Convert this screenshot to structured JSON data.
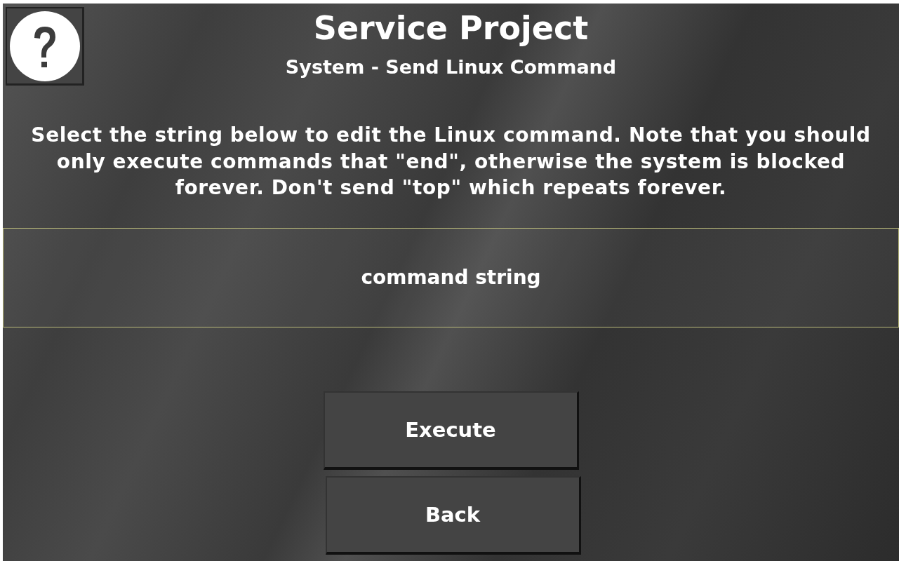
{
  "title": "Service Project",
  "subtitle": "System - Send Linux Command",
  "instructions": "Select the string below to edit the Linux command. Note that you should only execute commands that \"end\", otherwise the system is blocked forever. Don't send \"top\" which repeats forever.",
  "command_field": {
    "value": "command string"
  },
  "buttons": [
    "Execute",
    "Back"
  ]
}
